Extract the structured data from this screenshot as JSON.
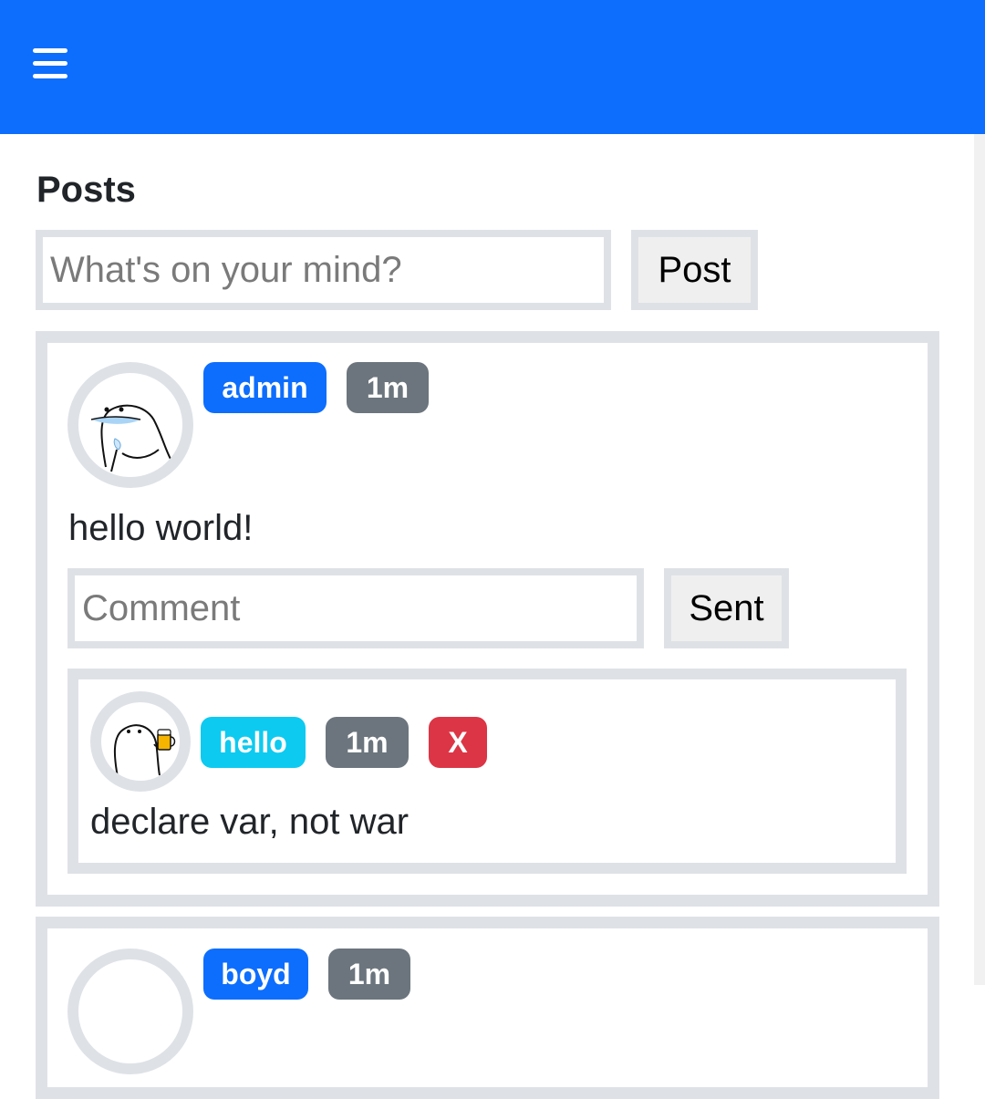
{
  "header": {
    "menu_icon": "hamburger-menu-icon",
    "color": "#0d6efd"
  },
  "page": {
    "title": "Posts"
  },
  "composer": {
    "placeholder": "What's on your mind?",
    "value": "",
    "post_label": "Post"
  },
  "posts": [
    {
      "author": "admin",
      "time": "1m",
      "text": "hello world!",
      "comment_placeholder": "Comment",
      "send_label": "Sent",
      "comments": [
        {
          "author": "hello",
          "time": "1m",
          "delete_label": "X",
          "text": "declare var, not war"
        }
      ]
    },
    {
      "author": "boyd",
      "time": "1m"
    }
  ],
  "colors": {
    "primary": "#0d6efd",
    "secondary": "#6c757d",
    "info": "#0dcaf0",
    "danger": "#dc3545",
    "border": "#dee2e6"
  }
}
